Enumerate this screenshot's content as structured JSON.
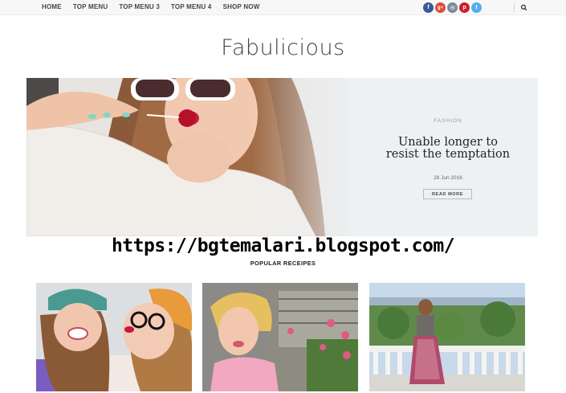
{
  "nav": {
    "items": [
      "HOME",
      "TOP MENU",
      "TOP MENU 3",
      "TOP MENU 4",
      "SHOP NOW"
    ]
  },
  "social": [
    {
      "icon": "facebook-icon",
      "glyph": "f",
      "color": "#3b5998"
    },
    {
      "icon": "google-plus-icon",
      "glyph": "g+",
      "color": "#dd4b39"
    },
    {
      "icon": "email-icon",
      "glyph": "✉",
      "color": "#7a8b99"
    },
    {
      "icon": "pinterest-icon",
      "glyph": "p",
      "color": "#cb2027"
    },
    {
      "icon": "twitter-icon",
      "glyph": "t",
      "color": "#55acee"
    }
  ],
  "logo": "Fabulicious",
  "hero": {
    "category": "FASHION",
    "title": "Unable longer to resist the temptation",
    "date": "28 Jun 2016",
    "button": "READ MORE"
  },
  "watermark": "https://bgtemalari.blogspot.com/",
  "section_title": "POPULAR RECEIPES",
  "colors": {
    "topbar": "#f7f7f7",
    "hero_bg": "#eef1f3"
  }
}
